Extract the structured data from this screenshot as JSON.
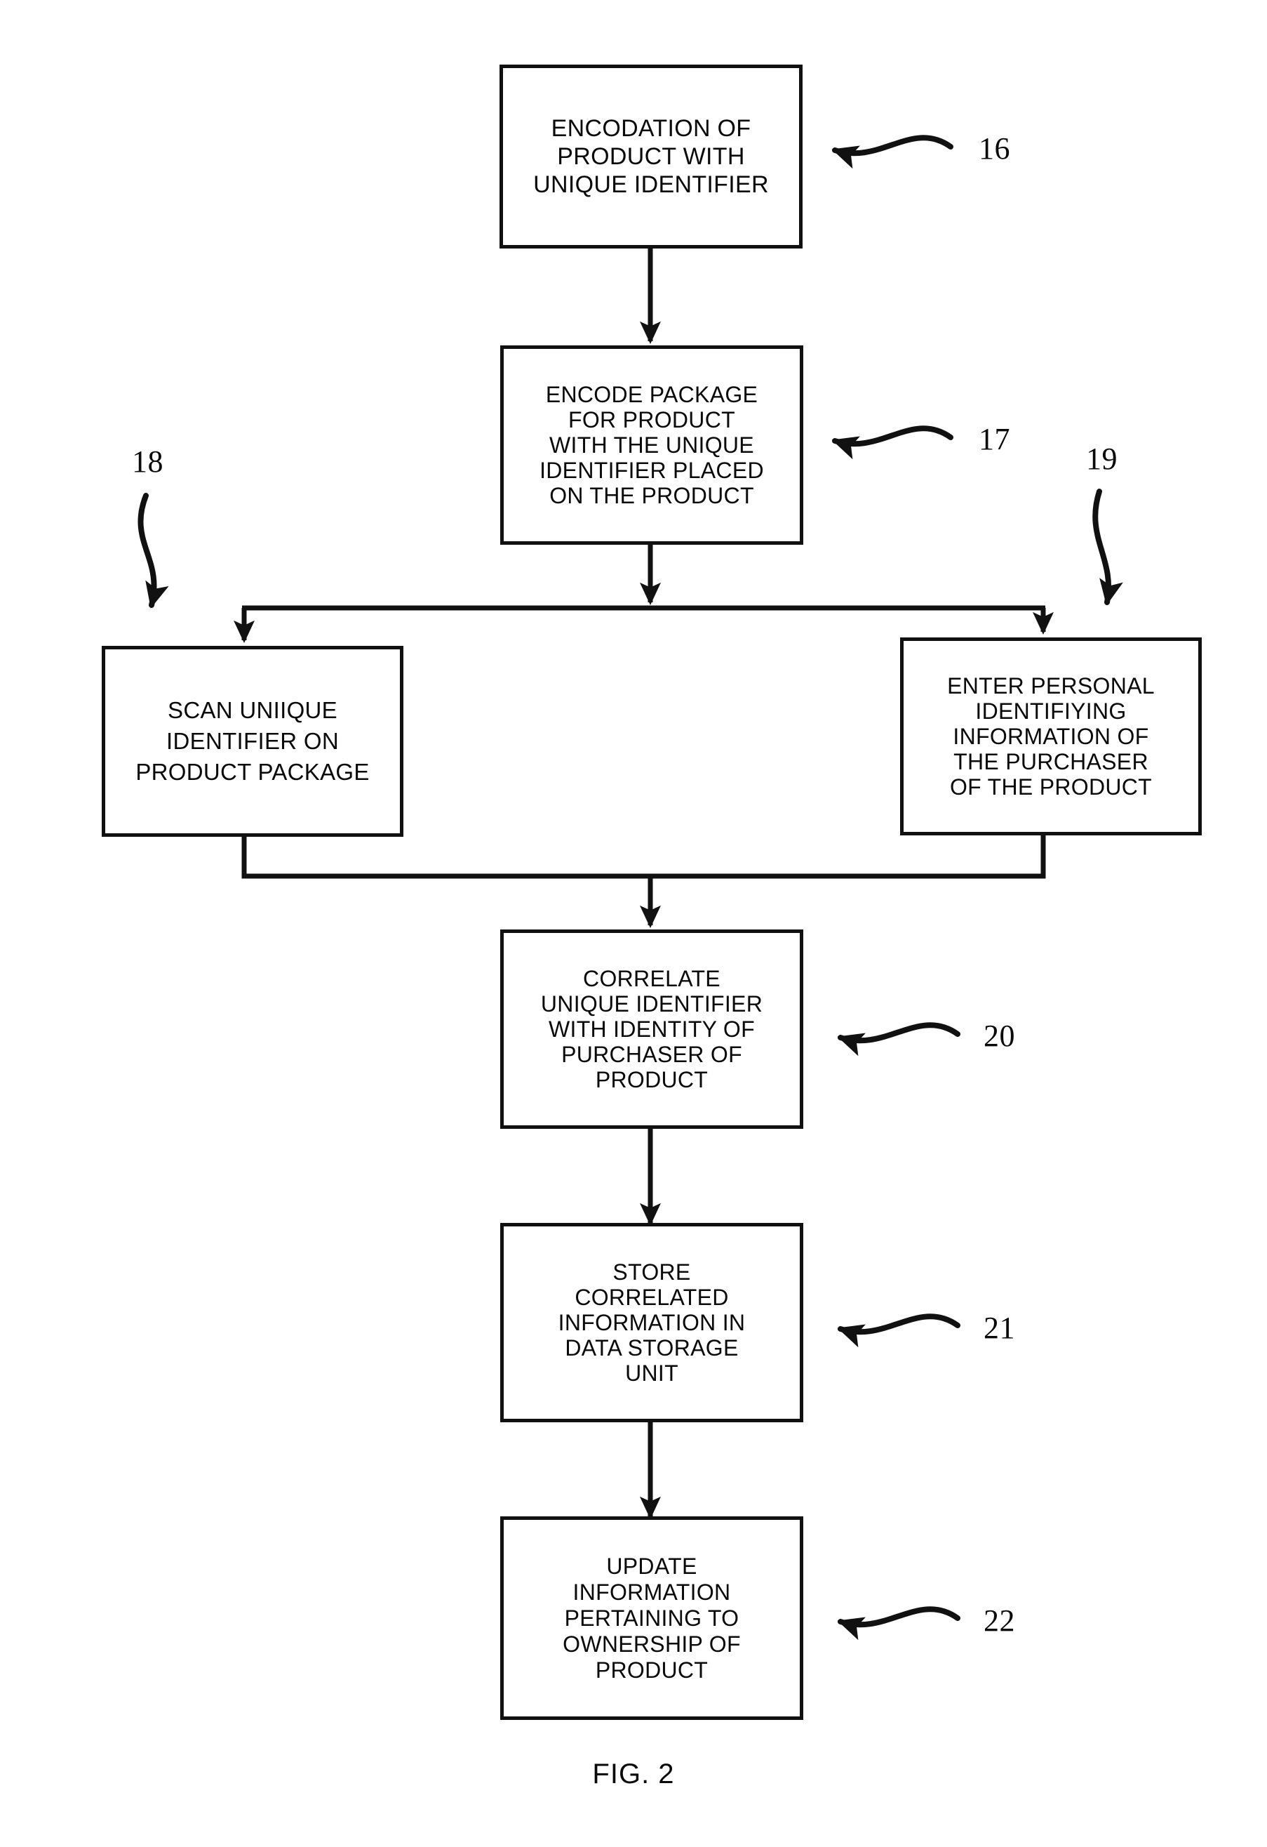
{
  "figure": {
    "caption": "FIG. 2",
    "type": "patent-flowchart"
  },
  "boxes": [
    {
      "id": "encodation-product",
      "ref": "16",
      "lines": [
        "ENCODATION OF",
        "PRODUCT WITH",
        "UNIQUE IDENTIFIER"
      ]
    },
    {
      "id": "encode-package",
      "ref": "17",
      "lines": [
        "ENCODE PACKAGE",
        "FOR PRODUCT",
        "WITH THE UNIQUE",
        "IDENTIFIER PLACED",
        "ON THE PRODUCT"
      ]
    },
    {
      "id": "scan-unique-identifier",
      "ref": "18",
      "lines": [
        "SCAN UNIIQUE",
        "IDENTIFIER ON",
        "PRODUCT PACKAGE"
      ]
    },
    {
      "id": "enter-personal-info",
      "ref": "19",
      "lines": [
        "ENTER PERSONAL",
        "IDENTIFIYING",
        "INFORMATION OF",
        "THE PURCHASER",
        "OF THE PRODUCT"
      ]
    },
    {
      "id": "correlate-identifier",
      "ref": "20",
      "lines": [
        "CORRELATE",
        "UNIQUE IDENTIFIER",
        "WITH IDENTITY OF",
        "PURCHASER OF",
        "PRODUCT"
      ]
    },
    {
      "id": "store-correlated",
      "ref": "21",
      "lines": [
        "STORE",
        "CORRELATED",
        "INFORMATION IN",
        "DATA STORAGE",
        "UNIT"
      ]
    },
    {
      "id": "update-ownership",
      "ref": "22",
      "lines": [
        "UPDATE",
        "INFORMATION",
        "PERTAINING TO",
        "OWNERSHIP OF",
        "PRODUCT"
      ]
    }
  ],
  "reference_numerals": {
    "r16": "16",
    "r17": "17",
    "r18": "18",
    "r19": "19",
    "r20": "20",
    "r21": "21",
    "r22": "22"
  },
  "colors": {
    "ink": "#111111",
    "paper": "#ffffff"
  }
}
